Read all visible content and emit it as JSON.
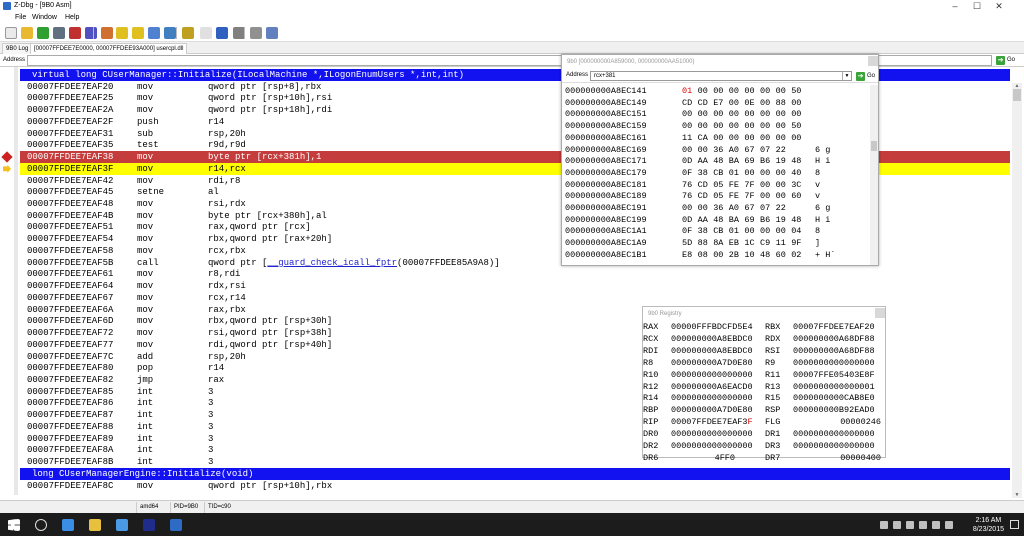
{
  "window": {
    "title": "Z-Dbg - [9B0 Asm]"
  },
  "menu": [
    "File",
    "Window",
    "Help"
  ],
  "tabs": [
    "9B0 Log",
    "[00007FFDEE7E0000, 00007FFDEE93A000] usercpl.dll"
  ],
  "address_bar": {
    "label": "Address",
    "value": "",
    "go_label": "Go"
  },
  "disasm": {
    "rows": [
      {
        "type": "header",
        "text": "virtual long CUserManager::Initialize(ILocalMachine *,ILogonEnumUsers *,int,int)"
      },
      {
        "addr": "00007FFDEE7EAF20",
        "mn": "mov",
        "ops": "qword ptr [rsp+8],rbx"
      },
      {
        "addr": "00007FFDEE7EAF25",
        "mn": "mov",
        "ops": "qword ptr [rsp+10h],rsi"
      },
      {
        "addr": "00007FFDEE7EAF2A",
        "mn": "mov",
        "ops": "qword ptr [rsp+18h],rdi"
      },
      {
        "addr": "00007FFDEE7EAF2F",
        "mn": "push",
        "ops": "r14"
      },
      {
        "addr": "00007FFDEE7EAF31",
        "mn": "sub",
        "ops": "rsp,20h"
      },
      {
        "addr": "00007FFDEE7EAF35",
        "mn": "test",
        "ops": "r9d,r9d"
      },
      {
        "addr": "00007FFDEE7EAF38",
        "mn": "mov",
        "ops": "byte ptr [rcx+381h],1",
        "state": "breakpoint"
      },
      {
        "addr": "00007FFDEE7EAF3F",
        "mn": "mov",
        "ops": "r14,rcx",
        "state": "current"
      },
      {
        "addr": "00007FFDEE7EAF42",
        "mn": "mov",
        "ops": "rdi,r8"
      },
      {
        "addr": "00007FFDEE7EAF45",
        "mn": "setne",
        "ops": "al"
      },
      {
        "addr": "00007FFDEE7EAF48",
        "mn": "mov",
        "ops": "rsi,rdx"
      },
      {
        "addr": "00007FFDEE7EAF4B",
        "mn": "mov",
        "ops": "byte ptr [rcx+380h],al"
      },
      {
        "addr": "00007FFDEE7EAF51",
        "mn": "mov",
        "ops": "rax,qword ptr [rcx]"
      },
      {
        "addr": "00007FFDEE7EAF54",
        "mn": "mov",
        "ops": "rbx,qword ptr [rax+20h]"
      },
      {
        "addr": "00007FFDEE7EAF58",
        "mn": "mov",
        "ops": "rcx,rbx"
      },
      {
        "addr": "00007FFDEE7EAF5B",
        "mn": "call",
        "ops": "qword ptr [",
        "sym": "__guard_check_icall_fptr",
        "ops_tail": "(00007FFDEE85A9A8)]"
      },
      {
        "addr": "00007FFDEE7EAF61",
        "mn": "mov",
        "ops": "r8,rdi"
      },
      {
        "addr": "00007FFDEE7EAF64",
        "mn": "mov",
        "ops": "rdx,rsi"
      },
      {
        "addr": "00007FFDEE7EAF67",
        "mn": "mov",
        "ops": "rcx,r14"
      },
      {
        "addr": "00007FFDEE7EAF6A",
        "mn": "mov",
        "ops": "rax,rbx"
      },
      {
        "addr": "00007FFDEE7EAF6D",
        "mn": "mov",
        "ops": "rbx,qword ptr [rsp+30h]"
      },
      {
        "addr": "00007FFDEE7EAF72",
        "mn": "mov",
        "ops": "rsi,qword ptr [rsp+38h]"
      },
      {
        "addr": "00007FFDEE7EAF77",
        "mn": "mov",
        "ops": "rdi,qword ptr [rsp+40h]"
      },
      {
        "addr": "00007FFDEE7EAF7C",
        "mn": "add",
        "ops": "rsp,20h"
      },
      {
        "addr": "00007FFDEE7EAF80",
        "mn": "pop",
        "ops": "r14"
      },
      {
        "addr": "00007FFDEE7EAF82",
        "mn": "jmp",
        "ops": "rax"
      },
      {
        "addr": "00007FFDEE7EAF85",
        "mn": "int",
        "ops": "3"
      },
      {
        "addr": "00007FFDEE7EAF86",
        "mn": "int",
        "ops": "3"
      },
      {
        "addr": "00007FFDEE7EAF87",
        "mn": "int",
        "ops": "3"
      },
      {
        "addr": "00007FFDEE7EAF88",
        "mn": "int",
        "ops": "3"
      },
      {
        "addr": "00007FFDEE7EAF89",
        "mn": "int",
        "ops": "3"
      },
      {
        "addr": "00007FFDEE7EAF8A",
        "mn": "int",
        "ops": "3"
      },
      {
        "addr": "00007FFDEE7EAF8B",
        "mn": "int",
        "ops": "3"
      },
      {
        "type": "header",
        "text": "long CUserManagerEngine::Initialize(void)"
      },
      {
        "addr": "00007FFDEE7EAF8C",
        "mn": "mov",
        "ops": "qword ptr [rsp+10h],rbx"
      }
    ]
  },
  "memory": {
    "title": "9b0 [000000000A859000, 000000000AA51000)",
    "address_label": "Address",
    "address_value": "rcx+381",
    "go_label": "Go",
    "rows": [
      {
        "addr": "000000000A8EC141",
        "bytes": [
          "01",
          "00",
          "00",
          "00",
          "00",
          "00",
          "00",
          "50"
        ],
        "chars": "",
        "changed": [
          0
        ]
      },
      {
        "addr": "000000000A8EC149",
        "bytes": [
          "CD",
          "CD",
          "E7",
          "00",
          "0E",
          "00",
          "88",
          "00"
        ],
        "chars": ""
      },
      {
        "addr": "000000000A8EC151",
        "bytes": [
          "00",
          "00",
          "00",
          "00",
          "00",
          "00",
          "00",
          "00"
        ],
        "chars": ""
      },
      {
        "addr": "000000000A8EC159",
        "bytes": [
          "00",
          "00",
          "00",
          "00",
          "00",
          "00",
          "00",
          "50"
        ],
        "chars": ""
      },
      {
        "addr": "000000000A8EC161",
        "bytes": [
          "11",
          "CA",
          "00",
          "00",
          "00",
          "00",
          "00",
          "00"
        ],
        "chars": ""
      },
      {
        "addr": "000000000A8EC169",
        "bytes": [
          "00",
          "00",
          "36",
          "A0",
          "67",
          "07",
          "22",
          ""
        ],
        "chars": "6 g"
      },
      {
        "addr": "000000000A8EC171",
        "bytes": [
          "0D",
          "AA",
          "48",
          "BA",
          "69",
          "B6",
          "19",
          "48"
        ],
        "chars": "H i"
      },
      {
        "addr": "000000000A8EC179",
        "bytes": [
          "0F",
          "38",
          "CB",
          "01",
          "00",
          "00",
          "00",
          "40"
        ],
        "chars": "8"
      },
      {
        "addr": "000000000A8EC181",
        "bytes": [
          "76",
          "CD",
          "05",
          "FE",
          "7F",
          "00",
          "00",
          "3C"
        ],
        "chars": "v"
      },
      {
        "addr": "000000000A8EC189",
        "bytes": [
          "76",
          "CD",
          "05",
          "FE",
          "7F",
          "00",
          "00",
          "60"
        ],
        "chars": "v"
      },
      {
        "addr": "000000000A8EC191",
        "bytes": [
          "00",
          "00",
          "36",
          "A0",
          "67",
          "07",
          "22",
          ""
        ],
        "chars": "6 g"
      },
      {
        "addr": "000000000A8EC199",
        "bytes": [
          "0D",
          "AA",
          "48",
          "BA",
          "69",
          "B6",
          "19",
          "48"
        ],
        "chars": "H i"
      },
      {
        "addr": "000000000A8EC1A1",
        "bytes": [
          "0F",
          "38",
          "CB",
          "01",
          "00",
          "00",
          "00",
          "04"
        ],
        "chars": "8"
      },
      {
        "addr": "000000000A8EC1A9",
        "bytes": [
          "5D",
          "88",
          "8A",
          "EB",
          "1C",
          "C9",
          "11",
          "9F"
        ],
        "chars": "]"
      },
      {
        "addr": "000000000A8EC1B1",
        "bytes": [
          "E8",
          "08",
          "00",
          "2B",
          "10",
          "48",
          "60",
          "02"
        ],
        "chars": "+ H`"
      }
    ]
  },
  "registers": {
    "title": "9b0 Registry",
    "rows": [
      {
        "n1": "RAX",
        "v1": "00000FFFBDCFD5E4",
        "n2": "RBX",
        "v2": "00007FFDEE7EAF20"
      },
      {
        "n1": "RCX",
        "v1": "000000000A8EBDC0",
        "n2": "RDX",
        "v2": "000000000A68DF88"
      },
      {
        "n1": "RDI",
        "v1": "000000000A8EBDC0",
        "n2": "RSI",
        "v2": "000000000A68DF88"
      },
      {
        "n1": "R8",
        "v1": "000000000A7D0E80",
        "n2": "R9",
        "v2": "0000000000000000"
      },
      {
        "n1": "R10",
        "v1": "0000000000000000",
        "n2": "R11",
        "v2": "00007FFE05403E8F"
      },
      {
        "n1": "R12",
        "v1": "000000000A6EACD0",
        "n2": "R13",
        "v2": "0000000000000001"
      },
      {
        "n1": "R14",
        "v1": "0000000000000000",
        "n2": "R15",
        "v2": "0000000000CAB8E0"
      },
      {
        "n1": "RBP",
        "v1": "000000000A7D0E80",
        "n2": "RSP",
        "v2": "000000000B92EAD0"
      },
      {
        "n1": "RIP",
        "v1": "00007FFDEE7EAF3",
        "v1_hl": "F",
        "n2": "FLG",
        "v2": "00000246"
      },
      {
        "n1": "DR0",
        "v1": "0000000000000000",
        "n2": "DR1",
        "v2": "0000000000000000"
      },
      {
        "n1": "DR2",
        "v1": "0000000000000000",
        "n2": "DR3",
        "v2": "0000000000000000"
      },
      {
        "n1": "DR6",
        "v1": "4FF0",
        "n2": "DR7",
        "v2": "00000400"
      }
    ]
  },
  "status": [
    "amd64",
    "PID=9B0",
    "TID=c90"
  ],
  "taskbar": {
    "time": "2:16 AM",
    "date": "8/23/2015"
  },
  "icons": {
    "toolbar": [
      "new-icon",
      "open-icon",
      "refresh-icon",
      "back-icon",
      "stop-icon",
      "break-icon",
      "home-icon",
      "star-icon",
      "star-add-icon",
      "copy-icon",
      "window-icon",
      "run-icon",
      "text-icon",
      "font-icon",
      "print-icon",
      "settings-icon",
      "notes-icon"
    ],
    "toolbar_colors": [
      "#eaeaea",
      "#e8b830",
      "#30a030",
      "#607080",
      "#c03030",
      "#5050c0",
      "#d07030",
      "#e0c020",
      "#e0c020",
      "#5080d0",
      "#4080c0",
      "#c0a020",
      "#e0e0e0",
      "#3060c0",
      "#808080",
      "#909090",
      "#6080c0"
    ]
  }
}
